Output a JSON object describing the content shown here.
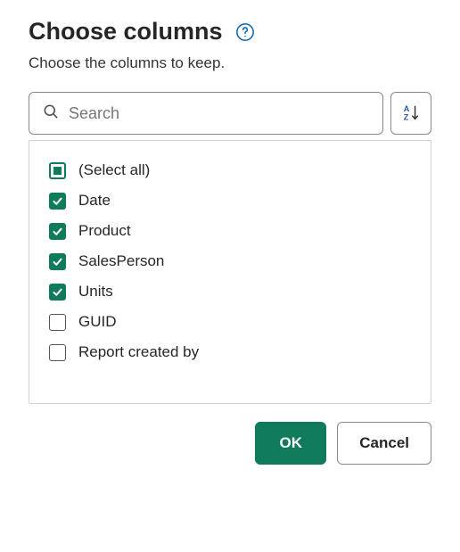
{
  "dialog": {
    "title": "Choose columns",
    "subtitle": "Choose the columns to keep."
  },
  "search": {
    "placeholder": "Search"
  },
  "columns": {
    "select_all_label": "(Select all)",
    "items": [
      {
        "label": "Date",
        "checked": true
      },
      {
        "label": "Product",
        "checked": true
      },
      {
        "label": "SalesPerson",
        "checked": true
      },
      {
        "label": "Units",
        "checked": true
      },
      {
        "label": "GUID",
        "checked": false
      },
      {
        "label": "Report created by",
        "checked": false
      }
    ]
  },
  "buttons": {
    "ok": "OK",
    "cancel": "Cancel"
  },
  "colors": {
    "accent": "#0f7b5a",
    "help_icon": "#0063b1"
  }
}
